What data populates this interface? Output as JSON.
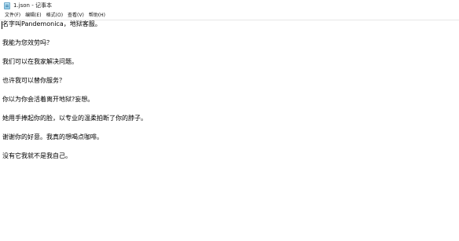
{
  "window": {
    "title": "1.json - 记事本"
  },
  "menu": {
    "items": [
      {
        "label": "文件(F)"
      },
      {
        "label": "编辑(E)"
      },
      {
        "label": "格式(O)"
      },
      {
        "label": "查看(V)"
      },
      {
        "label": "帮助(H)"
      }
    ]
  },
  "editor": {
    "lines": [
      "名字叫Pandemonica，地狱客服。",
      "",
      "我能为您效劳吗？",
      "",
      "我们可以在我家解决问题。",
      "",
      "也许我可以替你服务？",
      "",
      "你以为你会活着离开地狱?妄想。",
      "",
      "她用手捧起你的脸，以专业的温柔拍断了你的脖子。",
      "",
      "谢谢你的好意。我真的想喝点咖啡。",
      "",
      "没有它我就不是我自己。"
    ]
  }
}
